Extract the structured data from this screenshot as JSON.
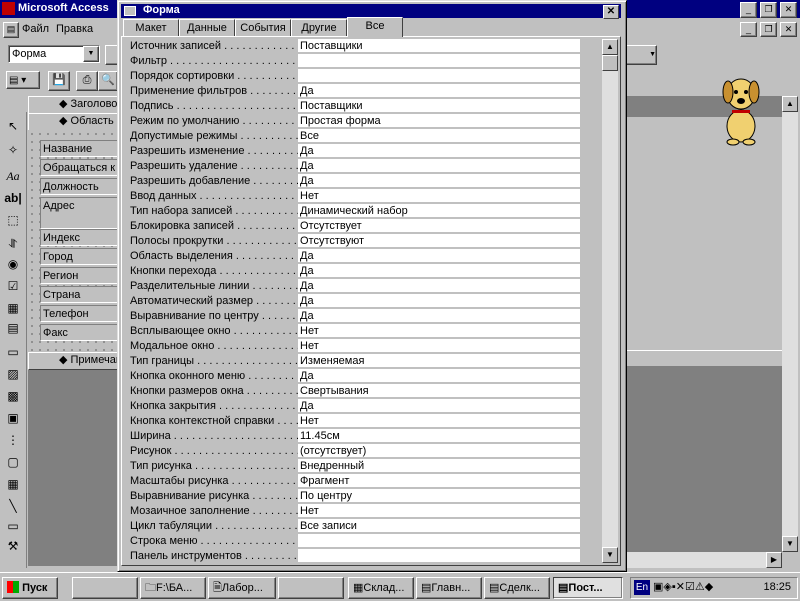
{
  "app": {
    "title": "Microsoft Access",
    "menu": [
      "Файл",
      "Правка"
    ]
  },
  "toolbar": {
    "object_selector": "Форма"
  },
  "form_design": {
    "sections": {
      "header": "Заголовок",
      "detail": "Область",
      "footer": "Примечан"
    },
    "fields": [
      "Название",
      "Обращаться к",
      "Должность",
      "Адрес",
      "Индекс",
      "Город",
      "Регион",
      "Страна",
      "Телефон",
      "Факс"
    ]
  },
  "property_sheet": {
    "title": "Форма",
    "close_symbol": "✕",
    "tabs": [
      "Макет",
      "Данные",
      "События",
      "Другие",
      "Все"
    ],
    "active_tab": "Все",
    "rows": [
      {
        "name": "Источник записей",
        "value": "Поставщики"
      },
      {
        "name": "Фильтр",
        "value": ""
      },
      {
        "name": "Порядок сортировки",
        "value": ""
      },
      {
        "name": "Применение фильтров",
        "value": "Да"
      },
      {
        "name": "Подпись",
        "value": "Поставщики"
      },
      {
        "name": "Режим по умолчанию",
        "value": "Простая форма"
      },
      {
        "name": "Допустимые режимы",
        "value": "Все"
      },
      {
        "name": "Разрешить изменение",
        "value": "Да"
      },
      {
        "name": "Разрешить удаление",
        "value": "Да"
      },
      {
        "name": "Разрешить добавление",
        "value": "Да"
      },
      {
        "name": "Ввод данных",
        "value": "Нет"
      },
      {
        "name": "Тип набора записей",
        "value": "Динамический набор"
      },
      {
        "name": "Блокировка записей",
        "value": "Отсутствует"
      },
      {
        "name": "Полосы прокрутки",
        "value": "Отсутствуют"
      },
      {
        "name": "Область выделения",
        "value": "Да"
      },
      {
        "name": "Кнопки перехода",
        "value": "Да"
      },
      {
        "name": "Разделительные линии",
        "value": "Да"
      },
      {
        "name": "Автоматический размер",
        "value": "Да"
      },
      {
        "name": "Выравнивание по центру",
        "value": "Да"
      },
      {
        "name": "Всплывающее окно",
        "value": "Нет"
      },
      {
        "name": "Модальное окно",
        "value": "Нет"
      },
      {
        "name": "Тип границы",
        "value": "Изменяемая"
      },
      {
        "name": "Кнопка оконного меню",
        "value": "Да"
      },
      {
        "name": "Кнопки размеров окна",
        "value": "Свертывания"
      },
      {
        "name": "Кнопка закрытия",
        "value": "Да"
      },
      {
        "name": "Кнопка контекстной справки",
        "value": "Нет"
      },
      {
        "name": "Ширина",
        "value": "11.45см"
      },
      {
        "name": "Рисунок",
        "value": "(отсутствует)"
      },
      {
        "name": "Тип рисунка",
        "value": "Внедренный"
      },
      {
        "name": "Масштабы рисунка",
        "value": "Фрагмент"
      },
      {
        "name": "Выравнивание рисунка",
        "value": "По центру"
      },
      {
        "name": "Мозаичное заполнение",
        "value": "Нет"
      },
      {
        "name": "Цикл табуляции",
        "value": "Все записи"
      },
      {
        "name": "Строка меню",
        "value": ""
      },
      {
        "name": "Панель инструментов",
        "value": ""
      }
    ]
  },
  "taskbar": {
    "start_label": "Пуск",
    "buttons": [
      "F:\\БА...",
      "Лабор...",
      "Склад...",
      "Главн...",
      "Сделк...",
      "Пост..."
    ],
    "active_button": "Пост...",
    "language": "En",
    "clock": "18:25"
  }
}
